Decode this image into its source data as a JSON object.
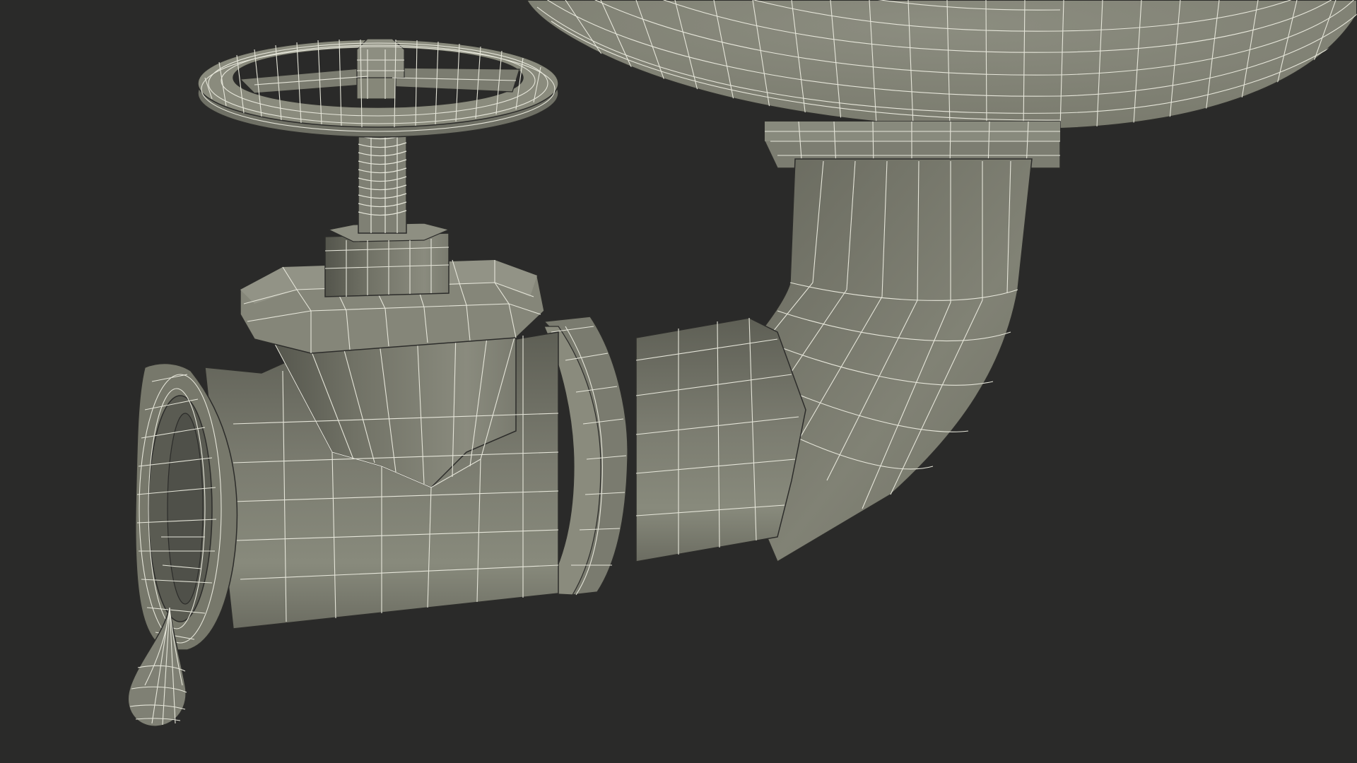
{
  "scene": {
    "background_color": "#2a2a29",
    "model_color": "#77786b",
    "wire_color": "#e6e6da",
    "shade_color": "#5f6055",
    "highlight_color": "#8a8b7d"
  }
}
